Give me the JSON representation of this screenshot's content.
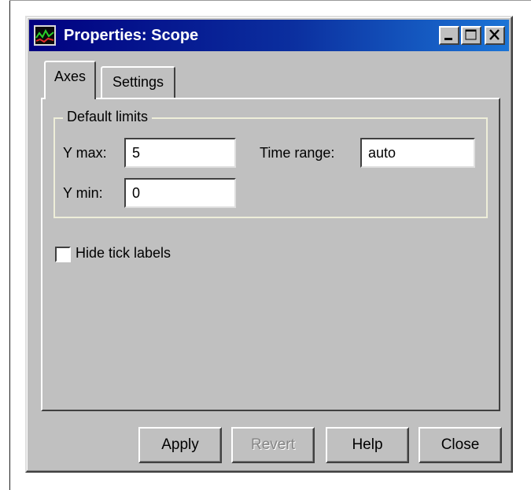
{
  "window": {
    "title": "Properties: Scope"
  },
  "tabs": [
    {
      "label": "Axes",
      "selected": true
    },
    {
      "label": "Settings",
      "selected": false
    }
  ],
  "default_limits": {
    "legend": "Default limits",
    "y_max": {
      "label": "Y max:",
      "value": "5"
    },
    "y_min": {
      "label": "Y min:",
      "value": "0"
    },
    "time_range": {
      "label": "Time range:",
      "value": "auto"
    }
  },
  "options": {
    "hide_tick_labels": {
      "label": "Hide tick labels",
      "checked": false
    }
  },
  "buttons": {
    "apply": "Apply",
    "revert": "Revert",
    "help": "Help",
    "close": "Close"
  },
  "icons": {
    "app": "scope-app-icon",
    "minimize": "minimize-icon",
    "maximize": "maximize-icon",
    "close": "close-icon"
  },
  "colors": {
    "titlebar_start": "#000080",
    "titlebar_end": "#1b74d6",
    "face": "#c0c0c0"
  }
}
